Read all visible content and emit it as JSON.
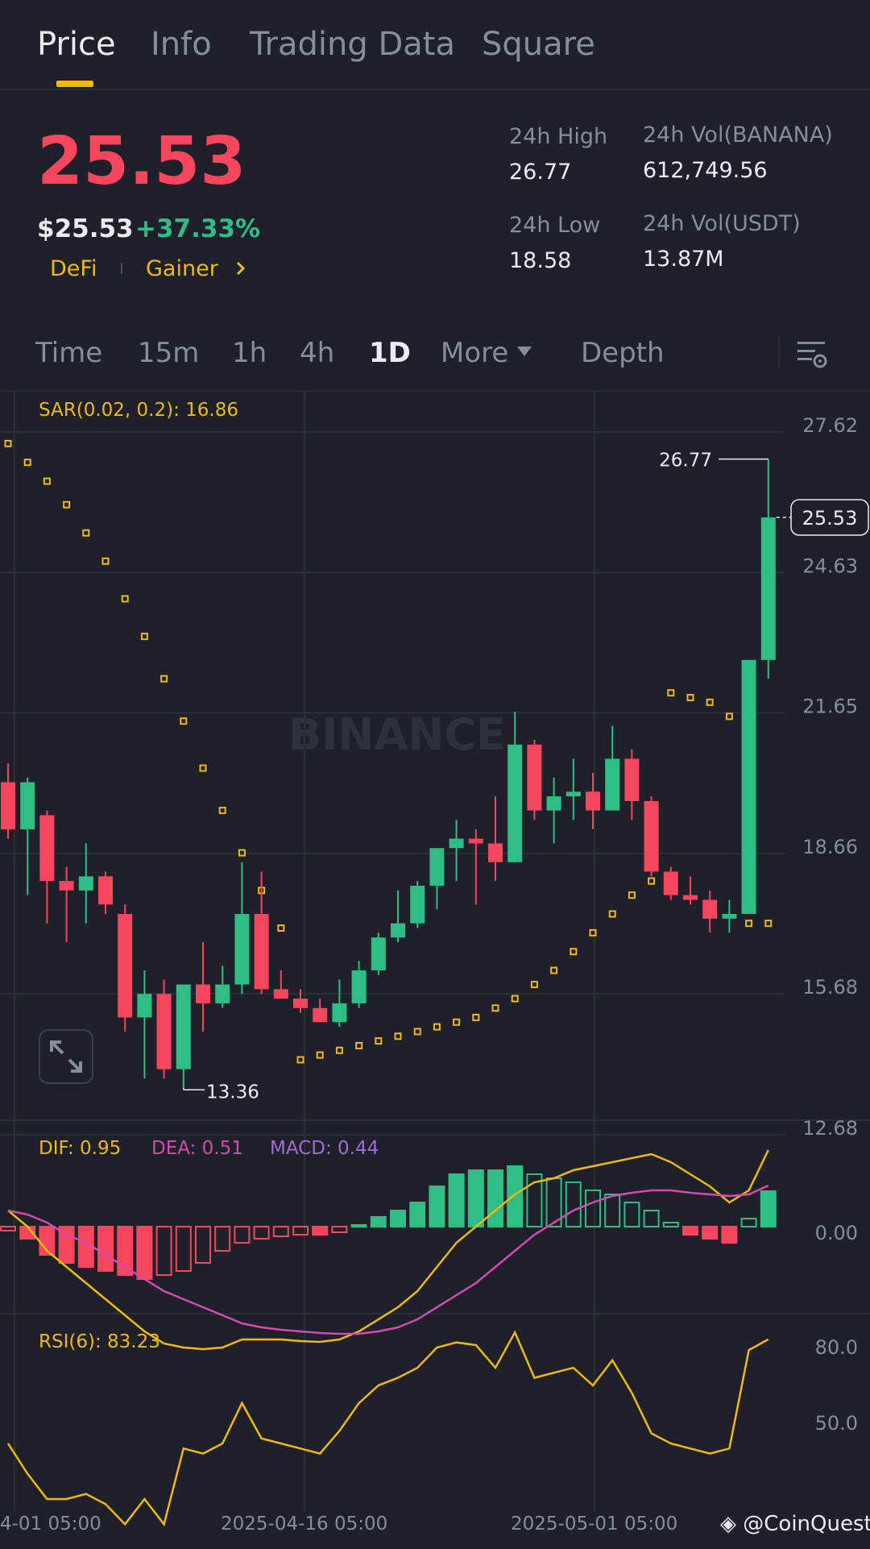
{
  "tabs": [
    "Price",
    "Info",
    "Trading Data",
    "Square"
  ],
  "header": {
    "price": "25.53",
    "price_usd": "$25.53",
    "change": "+37.33%",
    "tags": [
      "DeFi",
      "Gainer"
    ],
    "stats": {
      "high_label": "24h High",
      "high_value": "26.77",
      "low_label": "24h Low",
      "low_value": "18.58",
      "vol_base_label": "24h Vol(BANANA)",
      "vol_base_value": "612,749.56",
      "vol_quote_label": "24h Vol(USDT)",
      "vol_quote_value": "13.87M"
    }
  },
  "intervals": [
    "Time",
    "15m",
    "1h",
    "4h",
    "1D",
    "More",
    "Depth"
  ],
  "colors": {
    "up": "#2ebd85",
    "down": "#f6465d",
    "accent": "#f0b90b",
    "dea": "#d549b1",
    "macd": "#a66ad4"
  },
  "watermark": "BINANCE",
  "chart_data": [
    {
      "type": "candlestick",
      "indicator_label": "SAR(0.02, 0.2): 16.86",
      "y_ticks": [
        "27.62",
        "24.63",
        "21.65",
        "18.66",
        "15.68",
        "12.68"
      ],
      "ylim": [
        12.68,
        27.62
      ],
      "last_price_label": "25.53",
      "high_annotation": "26.77",
      "low_annotation": "13.36",
      "x_ticks": [
        "4-01 05:00",
        "2025-04-16 05:00",
        "2025-05-01 05:00"
      ],
      "candles": [
        {
          "o": 19.9,
          "h": 20.3,
          "l": 18.7,
          "c": 18.9
        },
        {
          "o": 18.9,
          "h": 20.0,
          "l": 17.5,
          "c": 19.9
        },
        {
          "o": 19.2,
          "h": 19.3,
          "l": 16.9,
          "c": 17.8
        },
        {
          "o": 17.8,
          "h": 18.1,
          "l": 16.5,
          "c": 17.6
        },
        {
          "o": 17.6,
          "h": 18.6,
          "l": 16.9,
          "c": 17.9
        },
        {
          "o": 17.9,
          "h": 18.0,
          "l": 17.1,
          "c": 17.3
        },
        {
          "o": 17.1,
          "h": 17.3,
          "l": 14.6,
          "c": 14.9
        },
        {
          "o": 14.9,
          "h": 15.9,
          "l": 13.6,
          "c": 15.4
        },
        {
          "o": 15.4,
          "h": 15.7,
          "l": 13.6,
          "c": 13.8
        },
        {
          "o": 13.8,
          "h": 15.6,
          "l": 13.4,
          "c": 15.6
        },
        {
          "o": 15.6,
          "h": 16.5,
          "l": 14.6,
          "c": 15.2
        },
        {
          "o": 15.2,
          "h": 16.0,
          "l": 15.1,
          "c": 15.6
        },
        {
          "o": 15.6,
          "h": 18.2,
          "l": 15.4,
          "c": 17.1
        },
        {
          "o": 17.1,
          "h": 18.0,
          "l": 15.4,
          "c": 15.5
        },
        {
          "o": 15.5,
          "h": 15.9,
          "l": 15.3,
          "c": 15.3
        },
        {
          "o": 15.3,
          "h": 15.5,
          "l": 15.0,
          "c": 15.1
        },
        {
          "o": 15.1,
          "h": 15.3,
          "l": 14.8,
          "c": 14.8
        },
        {
          "o": 14.8,
          "h": 15.7,
          "l": 14.7,
          "c": 15.2
        },
        {
          "o": 15.2,
          "h": 16.1,
          "l": 15.1,
          "c": 15.9
        },
        {
          "o": 15.9,
          "h": 16.7,
          "l": 15.8,
          "c": 16.6
        },
        {
          "o": 16.6,
          "h": 17.6,
          "l": 16.5,
          "c": 16.9
        },
        {
          "o": 16.9,
          "h": 17.8,
          "l": 16.8,
          "c": 17.7
        },
        {
          "o": 17.7,
          "h": 18.5,
          "l": 17.2,
          "c": 18.5
        },
        {
          "o": 18.5,
          "h": 19.1,
          "l": 17.8,
          "c": 18.7
        },
        {
          "o": 18.7,
          "h": 18.9,
          "l": 17.3,
          "c": 18.6
        },
        {
          "o": 18.6,
          "h": 19.6,
          "l": 17.8,
          "c": 18.2
        },
        {
          "o": 18.2,
          "h": 21.4,
          "l": 18.2,
          "c": 20.7
        },
        {
          "o": 20.7,
          "h": 20.8,
          "l": 19.1,
          "c": 19.3
        },
        {
          "o": 19.3,
          "h": 20.0,
          "l": 18.6,
          "c": 19.6
        },
        {
          "o": 19.6,
          "h": 20.4,
          "l": 19.1,
          "c": 19.7
        },
        {
          "o": 19.7,
          "h": 20.1,
          "l": 18.9,
          "c": 19.3
        },
        {
          "o": 19.3,
          "h": 21.1,
          "l": 19.3,
          "c": 20.4
        },
        {
          "o": 20.4,
          "h": 20.6,
          "l": 19.1,
          "c": 19.5
        },
        {
          "o": 19.5,
          "h": 19.6,
          "l": 17.9,
          "c": 18.0
        },
        {
          "o": 18.0,
          "h": 18.1,
          "l": 17.4,
          "c": 17.5
        },
        {
          "o": 17.5,
          "h": 17.9,
          "l": 17.3,
          "c": 17.4
        },
        {
          "o": 17.4,
          "h": 17.6,
          "l": 16.7,
          "c": 17.0
        },
        {
          "o": 17.0,
          "h": 17.4,
          "l": 16.7,
          "c": 17.1
        },
        {
          "o": 17.1,
          "h": 22.5,
          "l": 17.1,
          "c": 22.5
        },
        {
          "o": 22.5,
          "h": 26.77,
          "l": 22.1,
          "c": 25.53
        }
      ],
      "sar": [
        27.1,
        26.7,
        26.3,
        25.8,
        25.2,
        24.6,
        23.8,
        23.0,
        22.1,
        21.2,
        20.2,
        19.3,
        18.4,
        17.6,
        16.8,
        14.0,
        14.1,
        14.2,
        14.3,
        14.4,
        14.5,
        14.6,
        14.7,
        14.8,
        14.9,
        15.1,
        15.3,
        15.6,
        15.9,
        16.3,
        16.7,
        17.1,
        17.5,
        17.8,
        21.8,
        21.7,
        21.6,
        21.3,
        16.9,
        16.9
      ]
    },
    {
      "type": "line",
      "indicator_label": {
        "dif": "DIF: 0.95",
        "dea": "DEA: 0.51",
        "macd": "MACD: 0.44"
      },
      "y_ticks": [
        "0.00"
      ],
      "dif": [
        0.2,
        0.0,
        -0.3,
        -0.5,
        -0.7,
        -0.9,
        -1.1,
        -1.3,
        -1.45,
        -1.5,
        -1.52,
        -1.5,
        -1.4,
        -1.4,
        -1.4,
        -1.42,
        -1.43,
        -1.4,
        -1.3,
        -1.15,
        -1.0,
        -0.8,
        -0.5,
        -0.2,
        0.0,
        0.2,
        0.4,
        0.55,
        0.6,
        0.7,
        0.75,
        0.8,
        0.85,
        0.9,
        0.8,
        0.65,
        0.5,
        0.3,
        0.45,
        0.95
      ],
      "dea": [
        0.2,
        0.15,
        0.05,
        -0.1,
        -0.2,
        -0.35,
        -0.5,
        -0.65,
        -0.8,
        -0.9,
        -1.0,
        -1.1,
        -1.2,
        -1.25,
        -1.28,
        -1.3,
        -1.32,
        -1.33,
        -1.33,
        -1.3,
        -1.25,
        -1.15,
        -1.0,
        -0.85,
        -0.7,
        -0.5,
        -0.3,
        -0.1,
        0.05,
        0.2,
        0.3,
        0.38,
        0.42,
        0.45,
        0.45,
        0.42,
        0.4,
        0.38,
        0.4,
        0.51
      ],
      "macd": [
        -0.05,
        -0.15,
        -0.35,
        -0.45,
        -0.5,
        -0.55,
        -0.6,
        -0.65,
        -0.6,
        -0.55,
        -0.45,
        -0.3,
        -0.2,
        -0.15,
        -0.12,
        -0.1,
        -0.1,
        -0.07,
        0.02,
        0.12,
        0.2,
        0.3,
        0.5,
        0.65,
        0.7,
        0.7,
        0.75,
        0.65,
        0.6,
        0.55,
        0.45,
        0.4,
        0.3,
        0.2,
        0.05,
        -0.1,
        -0.15,
        -0.2,
        0.1,
        0.44
      ]
    },
    {
      "type": "line",
      "indicator_label": "RSI(6): 83.23",
      "y_ticks": [
        "80.0",
        "50.0"
      ],
      "values": [
        42,
        30,
        20,
        20,
        22,
        18,
        10,
        20,
        10,
        40,
        38,
        42,
        58,
        44,
        42,
        40,
        38,
        47,
        58,
        65,
        68,
        72,
        80,
        82,
        81,
        72,
        86,
        68,
        70,
        72,
        65,
        75,
        62,
        46,
        42,
        40,
        38,
        40,
        79,
        83.23
      ]
    }
  ]
}
